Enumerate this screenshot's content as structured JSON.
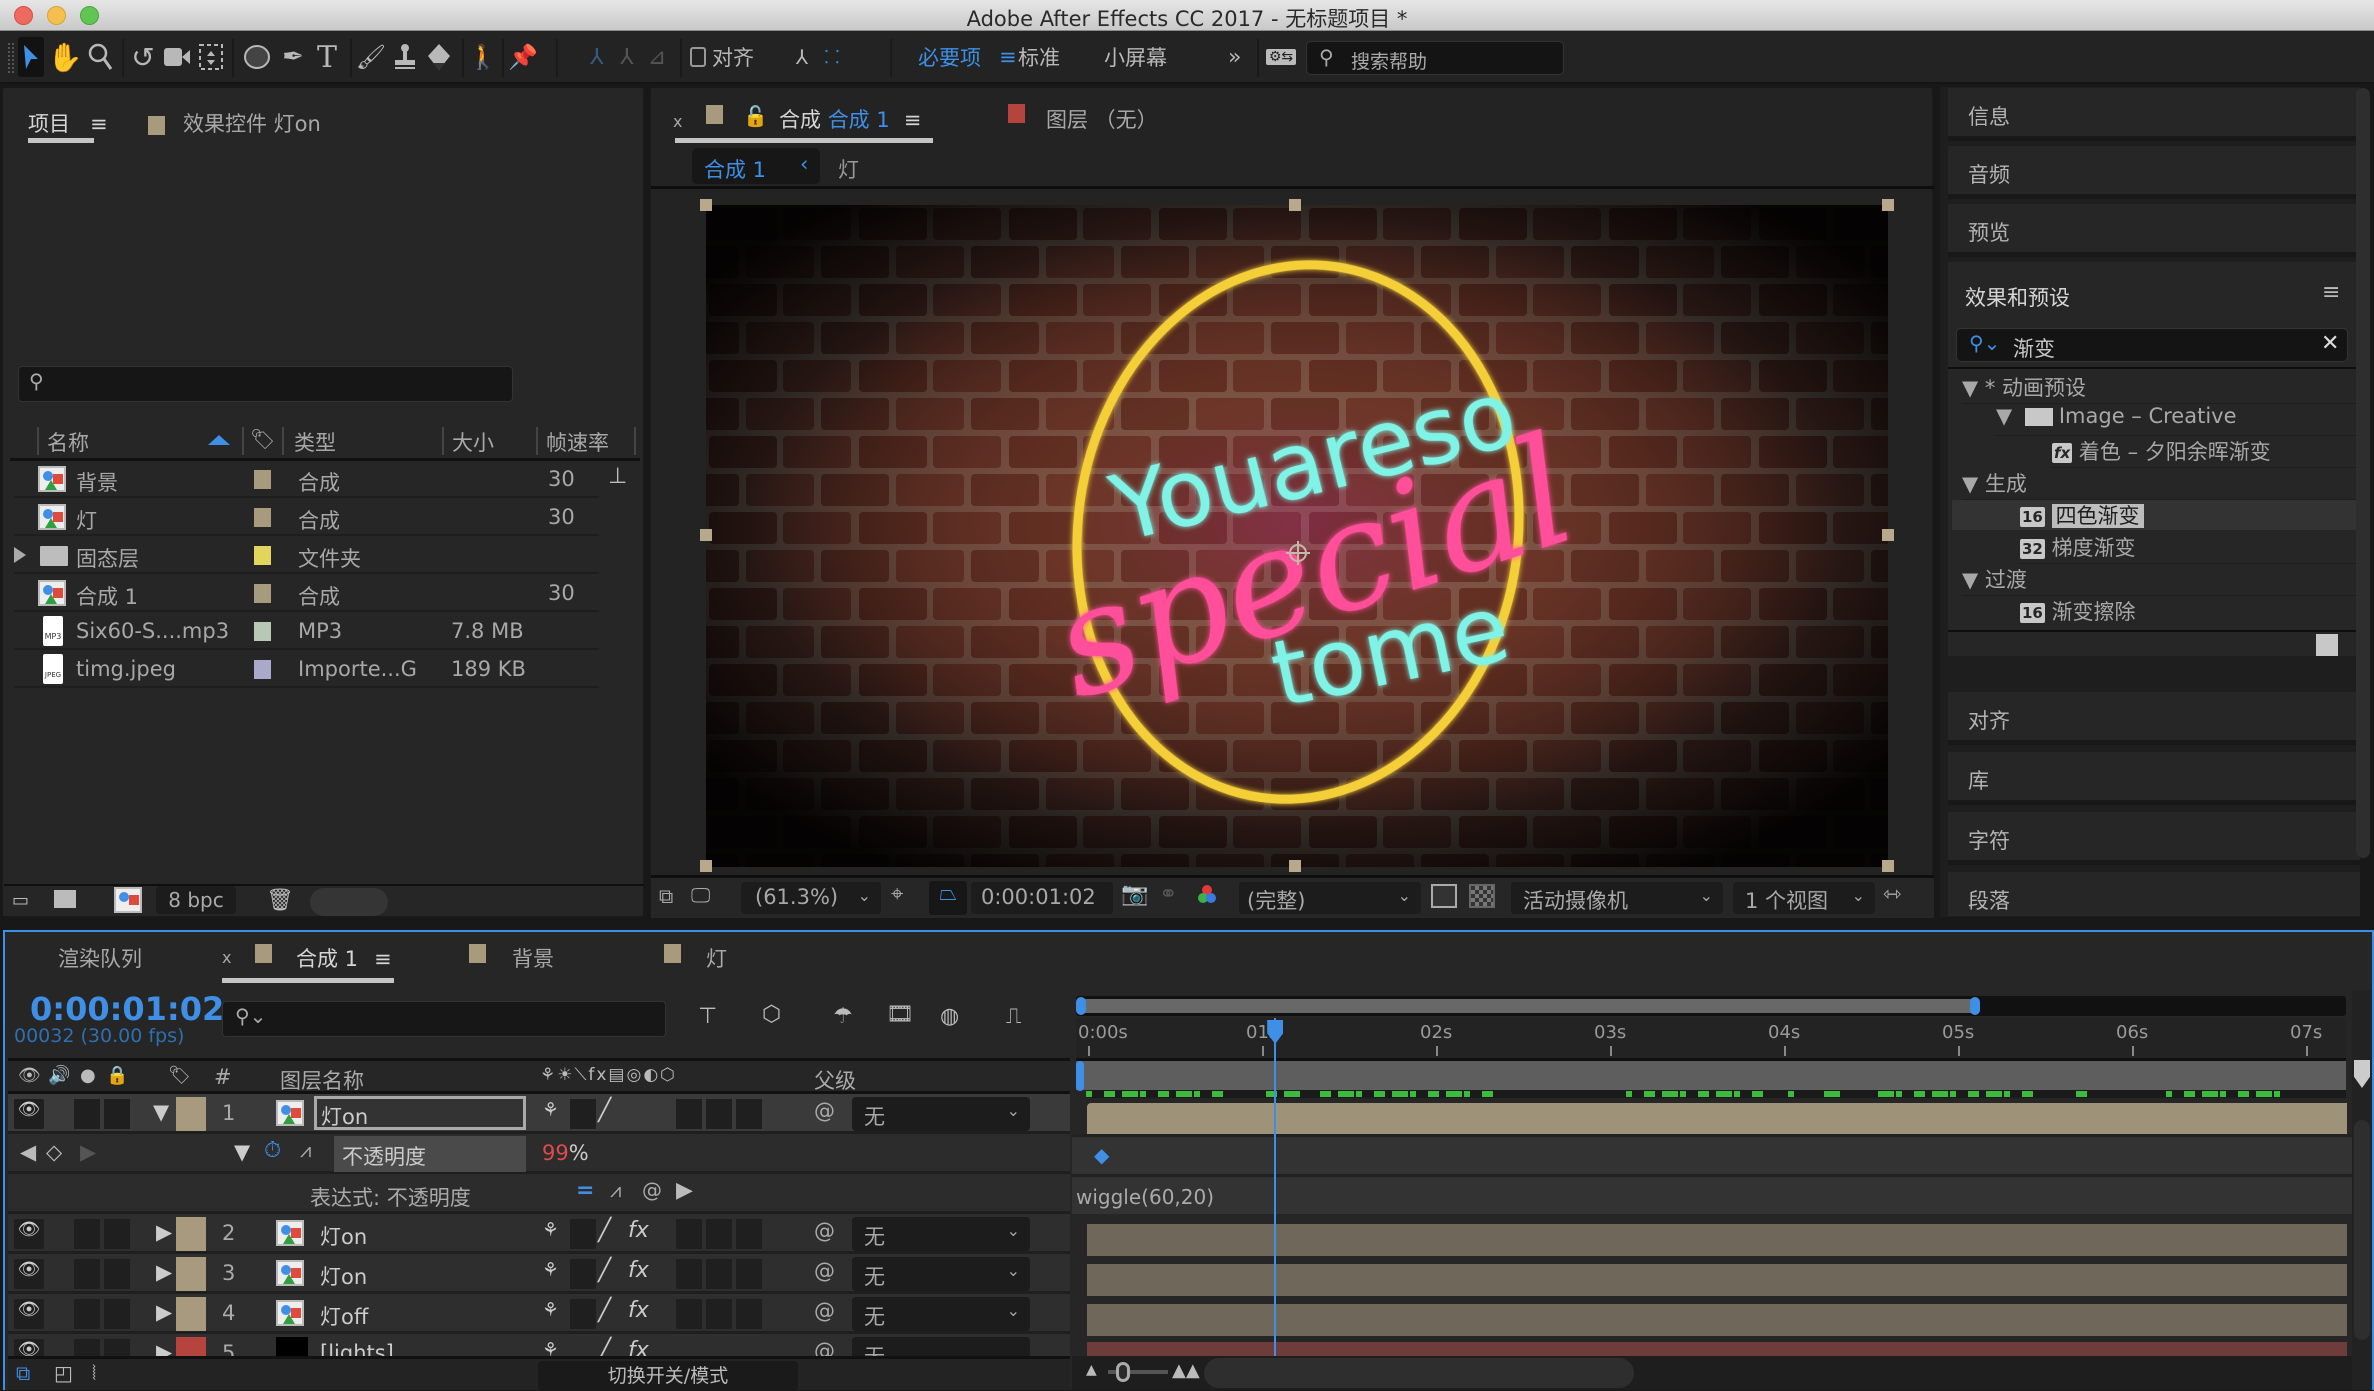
{
  "window": {
    "title": "Adobe After Effects CC 2017 - 无标题项目 *",
    "traffic_lights": {
      "close": "#ee6a5e",
      "minimize": "#f5bf4f",
      "maximize": "#61c554"
    }
  },
  "toolbar": {
    "tools": [
      {
        "icon": "selection-arrow-icon",
        "active": true
      },
      {
        "icon": "hand-icon"
      },
      {
        "icon": "zoom-magnifier-icon"
      },
      {
        "icon": "rotate-icon"
      },
      {
        "icon": "camera-icon"
      },
      {
        "icon": "pan-behind-icon"
      },
      {
        "icon": "ellipse-icon"
      },
      {
        "icon": "pen-icon"
      },
      {
        "icon": "type-icon"
      },
      {
        "icon": "brush-icon"
      },
      {
        "icon": "clone-stamp-icon"
      },
      {
        "icon": "eraser-icon"
      },
      {
        "icon": "roto-brush-icon"
      },
      {
        "icon": "puppet-pin-icon"
      }
    ],
    "snap_label": "对齐",
    "workspaces": {
      "active": "必要项",
      "items": [
        "标准",
        "小屏幕"
      ]
    },
    "overflow": "»",
    "search_help_placeholder": "搜索帮助"
  },
  "project_panel": {
    "tab_label": "项目",
    "effect_controls_tab": "效果控件 灯on",
    "effect_controls_color": "#a89a7c",
    "search_value": "",
    "columns": {
      "name": "名称",
      "type": "类型",
      "size": "大小",
      "fps": "帧速率"
    },
    "items": [
      {
        "icon": "composition-icon",
        "name": "背景",
        "label_color": "#a89a7c",
        "type": "合成",
        "size": "",
        "fps": "30"
      },
      {
        "icon": "composition-icon",
        "name": "灯",
        "label_color": "#a89a7c",
        "type": "合成",
        "size": "",
        "fps": "30"
      },
      {
        "icon": "folder-icon",
        "name": "固态层",
        "label_color": "#e2d55e",
        "type": "文件夹",
        "size": "",
        "fps": "",
        "expandable": true
      },
      {
        "icon": "composition-icon",
        "name": "合成 1",
        "label_color": "#a89a7c",
        "type": "合成",
        "size": "",
        "fps": "30"
      },
      {
        "icon": "mp3-file-icon",
        "name": "Six60-S....mp3",
        "label_color": "#b7c9b6",
        "type": "MP3",
        "size": "7.8 MB",
        "fps": ""
      },
      {
        "icon": "jpeg-file-icon",
        "name": "timg.jpeg",
        "label_color": "#a9a9c9",
        "type": "Importe...G",
        "size": "189 KB",
        "fps": ""
      }
    ],
    "bit_depth": "8 bpc"
  },
  "composition_panel": {
    "tab_prefix": "合成",
    "tab_name": "合成 1",
    "tab_color": "#a89a7c",
    "layer_tab": "图层 （无）",
    "layer_tab_color": "#b5443f",
    "breadcrumb": {
      "active": "合成 1",
      "next": "灯"
    },
    "artwork": {
      "line1": "Youareso",
      "line2": "special",
      "line3": "tome"
    },
    "footer": {
      "zoom": "(61.3%)",
      "timecode": "0:00:01:02",
      "resolution": "(完整)",
      "camera": "活动摄像机",
      "views": "1 个视图"
    }
  },
  "right_panel": {
    "collapsed_top": [
      "信息",
      "音频",
      "预览"
    ],
    "effects_title": "效果和预设",
    "search_value": "渐变",
    "tree": [
      {
        "level": 0,
        "label": "* 动画预设",
        "expanded": true
      },
      {
        "level": 1,
        "label": "Image – Creative",
        "icon": "folder-icon",
        "expanded": true
      },
      {
        "level": 2,
        "label": "着色 – 夕阳余晖渐变",
        "icon": "preset-fx-icon"
      },
      {
        "level": 0,
        "label": "生成",
        "expanded": true
      },
      {
        "level": 2,
        "label": "四色渐变",
        "badge": "16",
        "selected": true
      },
      {
        "level": 2,
        "label": "梯度渐变",
        "badge": "32"
      },
      {
        "level": 0,
        "label": "过渡",
        "expanded": true
      },
      {
        "level": 2,
        "label": "渐变擦除",
        "badge": "16"
      }
    ],
    "collapsed_bottom": [
      "对齐",
      "库",
      "字符",
      "段落"
    ]
  },
  "timeline": {
    "tabs": [
      {
        "label": "渲染队列"
      },
      {
        "label": "合成 1",
        "active": true,
        "color": "#a89a7c"
      },
      {
        "label": "背景",
        "color": "#a89a7c"
      },
      {
        "label": "灯",
        "color": "#a89a7c"
      }
    ],
    "current_time": "0:00:01:02",
    "frame_info": "00032 (30.00 fps)",
    "search_value": "",
    "columns": {
      "number": "#",
      "layer_name": "图层名称",
      "parent": "父级"
    },
    "layers": [
      {
        "num": "1",
        "name": "灯on",
        "color": "#a89a7c",
        "expanded": true,
        "selected": true,
        "has_fx": false,
        "parent": "无"
      },
      {
        "num": "2",
        "name": "灯on",
        "color": "#a89a7c",
        "has_fx": true,
        "parent": "无"
      },
      {
        "num": "3",
        "name": "灯on",
        "color": "#a89a7c",
        "has_fx": true,
        "parent": "无"
      },
      {
        "num": "4",
        "name": "灯off",
        "color": "#a89a7c",
        "has_fx": true,
        "parent": "无"
      },
      {
        "num": "5",
        "name": "[lights]",
        "color": "#b5443f",
        "has_fx": true,
        "parent": "无"
      }
    ],
    "property": {
      "name": "不透明度",
      "value": "99",
      "unit": "%"
    },
    "expression": {
      "label": "表达式: 不透明度",
      "code": "wiggle(60,20)"
    },
    "ruler_labels": [
      "0:00s",
      "01s",
      "02s",
      "03s",
      "04s",
      "05s",
      "06s",
      "07s"
    ],
    "work_area_end_seconds": 5.08,
    "playhead_seconds": 1.07,
    "toggle_label": "切换开关/模式"
  }
}
